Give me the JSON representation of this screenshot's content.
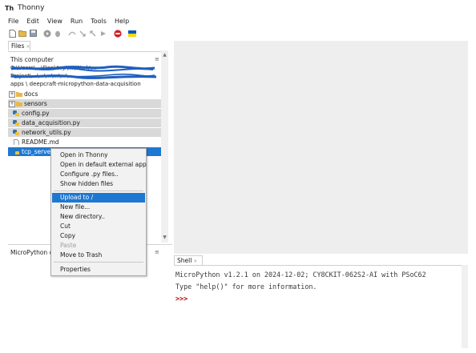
{
  "window": {
    "title": "Thonny",
    "logo_text": "Th"
  },
  "menubar": {
    "items": [
      "File",
      "Edit",
      "View",
      "Run",
      "Tools",
      "Help"
    ]
  },
  "toolbar": {
    "icons": [
      "new-file-icon",
      "open-folder-icon",
      "save-icon",
      "run-icon",
      "debug-icon",
      "step-over-icon",
      "step-into-icon",
      "step-out-icon",
      "resume-icon",
      "stop-icon",
      "ukraine-flag-icon"
    ],
    "colors": {
      "stop": "#d0202a",
      "flag_top": "#0057b7",
      "flag_bottom": "#ffd700"
    }
  },
  "files_panel": {
    "tab_label": "Files",
    "tab_close": "×",
    "location_label": "This computer",
    "menu_glyph": "≡",
    "path_lines": [
      "C:\\Users\\...\\Desktop\\...\\Work\\...",
      "Project\\...\\...\\...\\...\\...\\...",
      "apps \\ deepcraft-micropython-data-acquisition"
    ],
    "items": [
      {
        "name": "docs",
        "type": "folder",
        "expander": "+"
      },
      {
        "name": "sensors",
        "type": "folder",
        "expander": "+"
      },
      {
        "name": "config.py",
        "type": "python"
      },
      {
        "name": "data_acquisition.py",
        "type": "python"
      },
      {
        "name": "network_utils.py",
        "type": "python"
      },
      {
        "name": "README.md",
        "type": "file"
      },
      {
        "name": "tcp_server.py",
        "type": "python"
      }
    ]
  },
  "micropython_panel": {
    "label": "MicroPython d",
    "menu_glyph": "≡"
  },
  "context_menu": {
    "items": [
      "Open in Thonny",
      "Open in default external app",
      "Configure .py files..",
      "Show hidden files",
      "Upload to /",
      "New file...",
      "New directory..",
      "Cut",
      "Copy",
      "Paste",
      "Move to Trash",
      "Properties"
    ],
    "highlighted": "Upload to /",
    "disabled": [
      "Paste"
    ]
  },
  "shell": {
    "tab_label": "Shell",
    "tab_close": "×",
    "lines": [
      "MicroPython v1.2.1 on 2024-12-02; CY8CKIT-062S2-AI with PSoC62",
      "Type \"help()\" for more information."
    ],
    "prompt": ">>>"
  },
  "scroll": {
    "up": "▲",
    "down": "▼"
  },
  "colors": {
    "selection": "#1e78d2",
    "gray_row": "#d9d9d9",
    "editor_bg": "#eeeeee",
    "redaction": "#1f5fbf"
  }
}
